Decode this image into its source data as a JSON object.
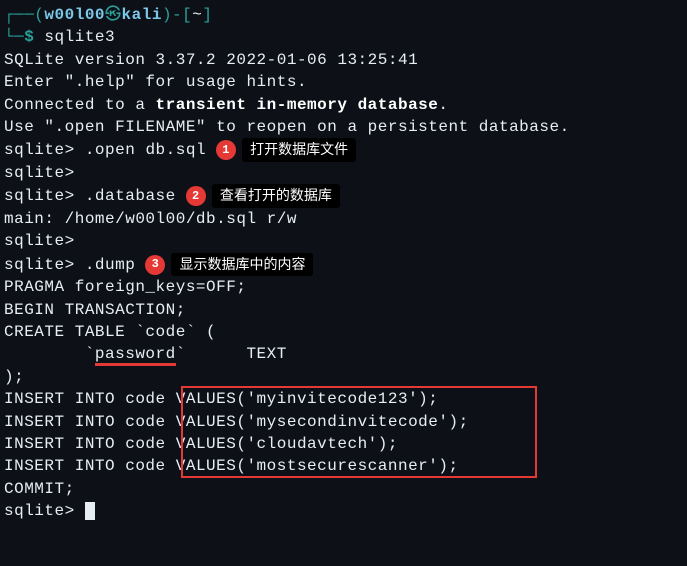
{
  "prompt": {
    "user": "w00l00",
    "host": "kali",
    "cwd": "~",
    "open_paren": "┌──(",
    "close_paren": ")-[",
    "close_bracket": "]",
    "line2_prefix": "└─",
    "dollar": "$",
    "skull": "㉿"
  },
  "command": "sqlite3",
  "output": {
    "version_line": "SQLite version 3.37.2 2022-01-06 13:25:41",
    "help_line": "Enter \".help\" for usage hints.",
    "connected_prefix": "Connected to a ",
    "connected_bold": "transient in-memory database",
    "connected_suffix": ".",
    "reopen_line": "Use \".open FILENAME\" to reopen on a persistent database."
  },
  "session": {
    "prompt": "sqlite>",
    "cmd_open": ".open db.sql",
    "cmd_database": ".database",
    "main_line": "main: /home/w00l00/db.sql r/w",
    "cmd_dump": ".dump",
    "pragma": "PRAGMA foreign_keys=OFF;",
    "begin": "BEGIN TRANSACTION;",
    "create_table": "CREATE TABLE `code` (",
    "col_indent": "        `",
    "col_name": "password",
    "col_suffix": "`      TEXT",
    "close_paren": ");",
    "insert_prefix": "INSERT INTO code ",
    "inserts": [
      "VALUES('myinvitecode123');",
      "VALUES('mysecondinvitecode');",
      "VALUES('cloudavtech');",
      "VALUES('mostsecurescanner');"
    ],
    "commit": "COMMIT;"
  },
  "annotations": {
    "one": "1",
    "one_label": "打开数据库文件",
    "two": "2",
    "two_label": "查看打开的数据库",
    "three": "3",
    "three_label": "显示数据库中的内容"
  }
}
